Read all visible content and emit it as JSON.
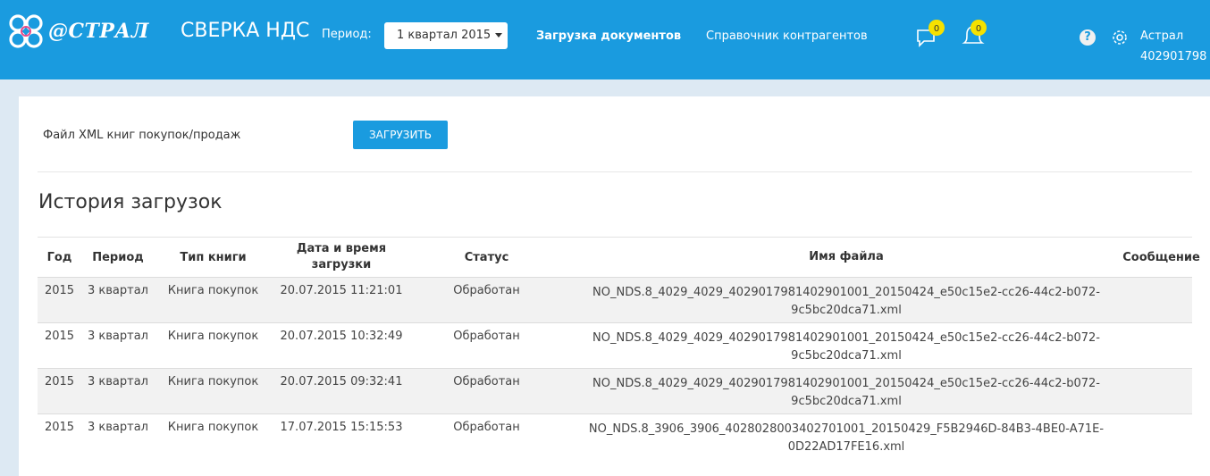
{
  "header": {
    "logo_text": "@СТРАЛ",
    "app_title": "СВЕРКА НДС",
    "period_label": "Период:",
    "period_value": "1 квартал 2015",
    "nav": [
      "Загрузка документов",
      "Справочник контрагентов"
    ],
    "messages_count": "0",
    "notifications_count": "0",
    "help_label": "?",
    "user_name": "Астрал",
    "user_inn": "402901798",
    "colors": {
      "brand": "#1a9bdf",
      "badge": "#f5e100"
    }
  },
  "upload": {
    "label": "Файл XML книг покупок/продаж",
    "button": "ЗАГРУЗИТЬ"
  },
  "history": {
    "title": "История загрузок",
    "columns": [
      "Год",
      "Период",
      "Тип книги",
      "Дата и время загрузки",
      "Статус",
      "Имя файла",
      "Сообщение"
    ],
    "rows": [
      {
        "year": "2015",
        "period": "3 квартал",
        "type": "Книга покупок",
        "datetime": "20.07.2015 11:21:01",
        "status": "Обработан",
        "file_line1": "NO_NDS.8_4029_4029_4029017981402901001_20150424_e50c15e2-cc26-44c2-b072-",
        "file_line2": "9c5bc20dca71.xml",
        "message": ""
      },
      {
        "year": "2015",
        "period": "3 квартал",
        "type": "Книга покупок",
        "datetime": "20.07.2015 10:32:49",
        "status": "Обработан",
        "file_line1": "NO_NDS.8_4029_4029_4029017981402901001_20150424_e50c15e2-cc26-44c2-b072-",
        "file_line2": "9c5bc20dca71.xml",
        "message": ""
      },
      {
        "year": "2015",
        "period": "3 квартал",
        "type": "Книга покупок",
        "datetime": "20.07.2015 09:32:41",
        "status": "Обработан",
        "file_line1": "NO_NDS.8_4029_4029_4029017981402901001_20150424_e50c15e2-cc26-44c2-b072-",
        "file_line2": "9c5bc20dca71.xml",
        "message": ""
      },
      {
        "year": "2015",
        "period": "3 квартал",
        "type": "Книга покупок",
        "datetime": "17.07.2015 15:15:53",
        "status": "Обработан",
        "file_line1": "NO_NDS.8_3906_3906_4028028003402701001_20150429_F5B2946D-84B3-4BE0-A71E-",
        "file_line2": "0D22AD17FE16.xml",
        "message": ""
      }
    ]
  }
}
